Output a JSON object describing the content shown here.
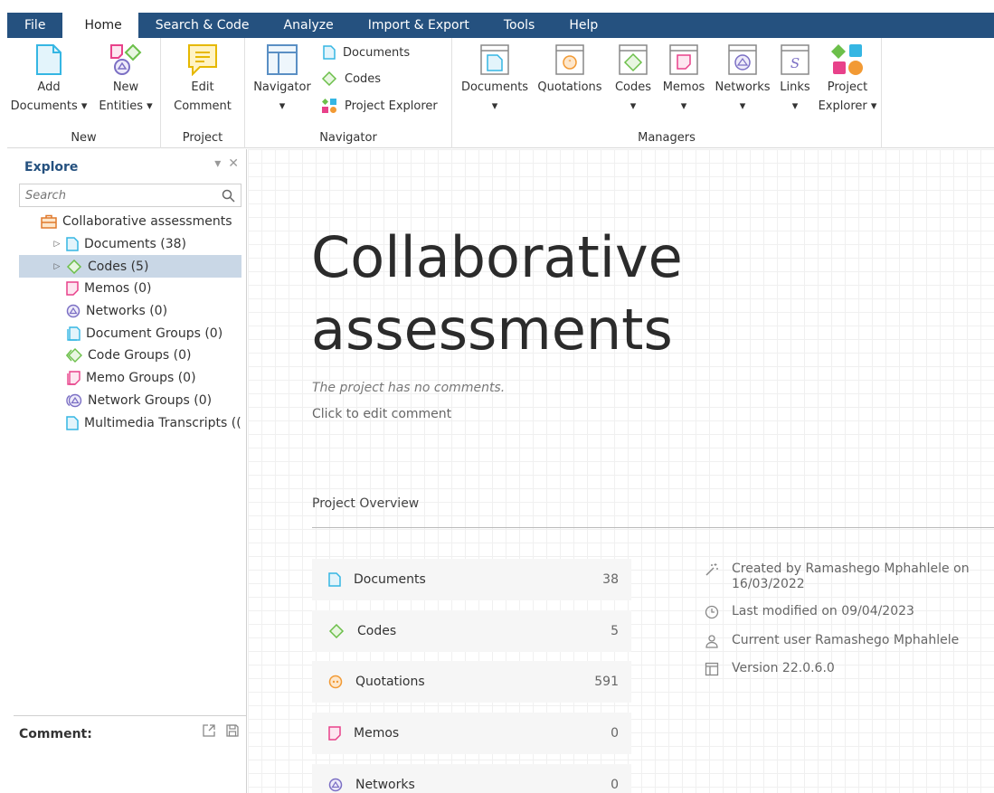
{
  "menu": [
    "File",
    "Home",
    "Search & Code",
    "Analyze",
    "Import & Export",
    "Tools",
    "Help"
  ],
  "ribbon": {
    "new": {
      "add_documents": [
        "Add",
        "Documents ▾"
      ],
      "new_entities": [
        "New",
        "Entities ▾"
      ],
      "group": "New"
    },
    "project": {
      "edit_comment": [
        "Edit",
        "Comment"
      ],
      "group": "Project"
    },
    "navigator": {
      "navigator_btn": [
        "Navigator",
        "▾"
      ],
      "documents": "Documents",
      "codes": "Codes",
      "project_explorer": "Project Explorer",
      "group": "Navigator"
    },
    "managers": {
      "documents": [
        "Documents",
        "▾"
      ],
      "quotations": [
        "Quotations",
        ""
      ],
      "codes": [
        "Codes",
        "▾"
      ],
      "memos": [
        "Memos",
        "▾"
      ],
      "networks": [
        "Networks",
        "▾"
      ],
      "links": [
        "Links",
        "▾"
      ],
      "project_explorer": [
        "Project",
        "Explorer ▾"
      ],
      "group": "Managers"
    }
  },
  "explore": {
    "title": "Explore",
    "search_placeholder": "Search",
    "items": [
      {
        "label": "Collaborative assessments"
      },
      {
        "label": "Documents (38)"
      },
      {
        "label": "Codes (5)"
      },
      {
        "label": "Memos (0)"
      },
      {
        "label": "Networks (0)"
      },
      {
        "label": "Document Groups (0)"
      },
      {
        "label": "Code Groups (0)"
      },
      {
        "label": "Memo Groups (0)"
      },
      {
        "label": "Network Groups (0)"
      },
      {
        "label": "Multimedia Transcripts (("
      }
    ],
    "comment_label": "Comment:"
  },
  "main": {
    "title_line1": "Collaborative",
    "title_line2": "assessments",
    "no_comments": "The project has no comments.",
    "edit_comment": "Click to edit comment",
    "overview": "Project Overview",
    "stats": [
      {
        "label": "Documents",
        "count": "38"
      },
      {
        "label": "Codes",
        "count": "5"
      },
      {
        "label": "Quotations",
        "count": "591"
      },
      {
        "label": "Memos",
        "count": "0"
      },
      {
        "label": "Networks",
        "count": "0"
      }
    ],
    "info": {
      "created_line1": "Created by Ramashego Mphahlele on",
      "created_line2": "16/03/2022",
      "modified": "Last modified on 09/04/2023",
      "user": "Current user Ramashego Mphahlele",
      "version": "Version 22.0.6.0"
    }
  },
  "colors": {
    "menubar": "#25517f",
    "documents": "#35b6e3",
    "codes": "#6cbf4a",
    "memos": "#e8418a",
    "networks": "#7b6fc4",
    "quotations": "#f29a34",
    "selection": "#c9d7e6"
  }
}
